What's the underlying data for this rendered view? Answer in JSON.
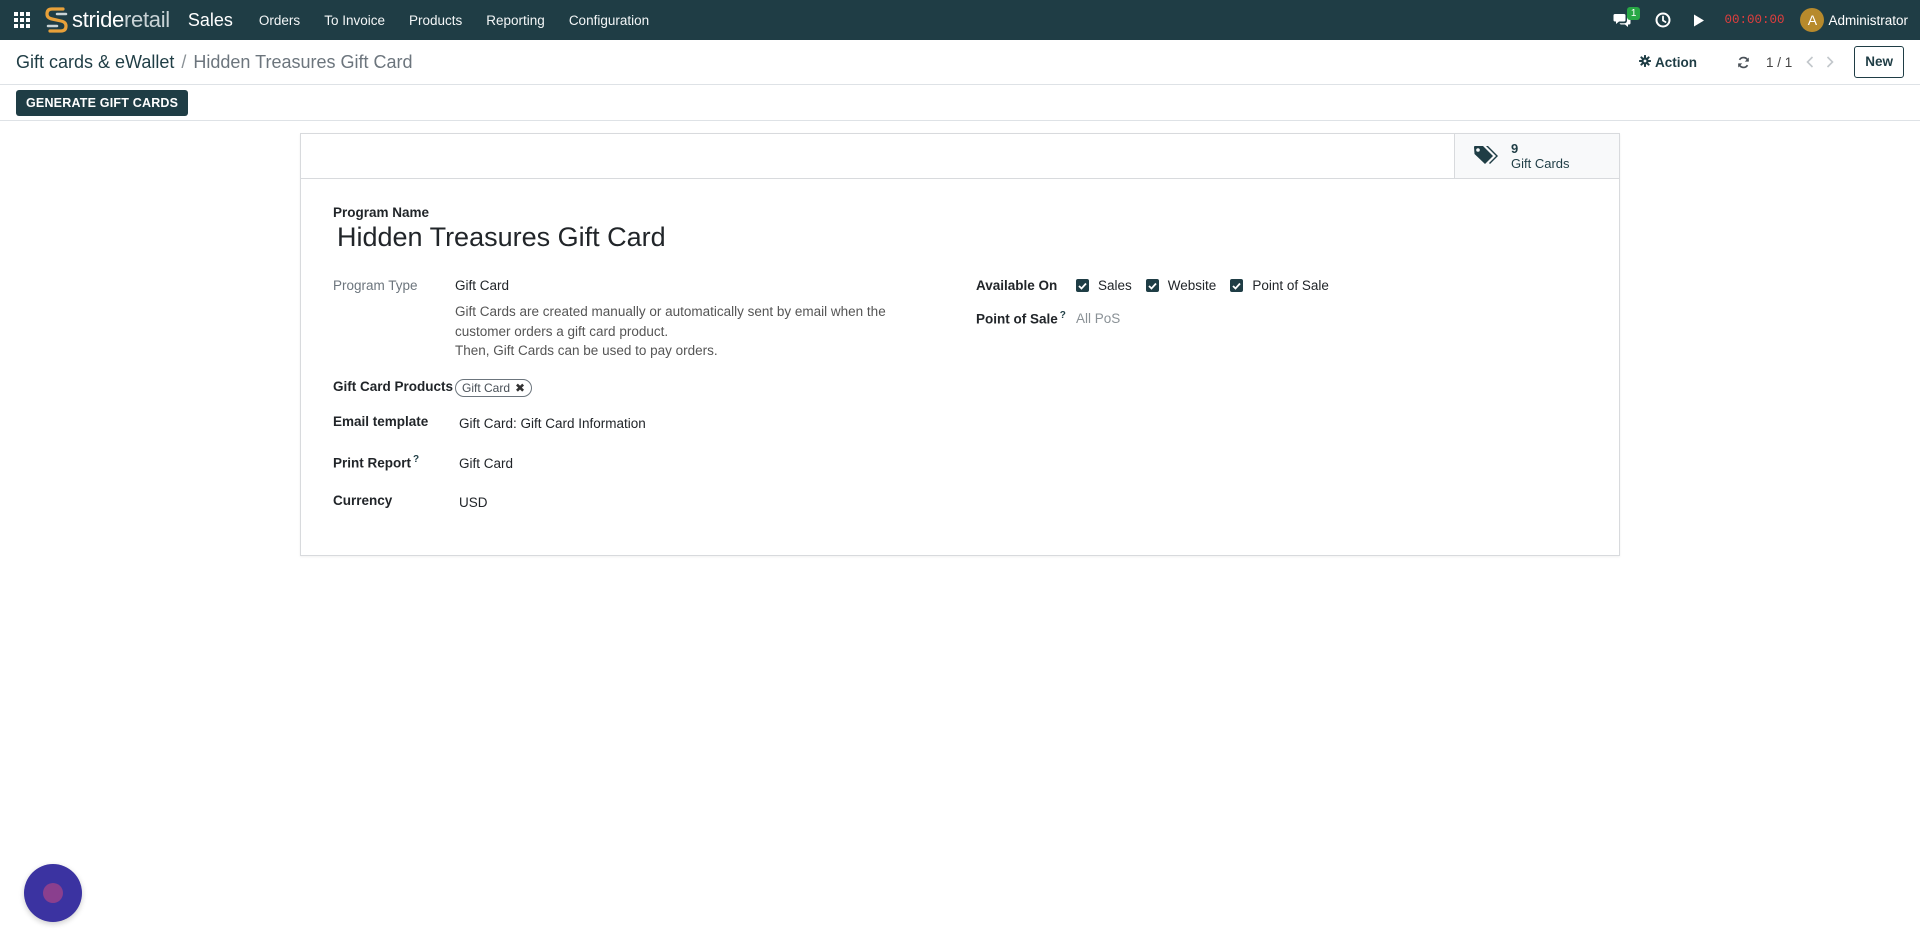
{
  "navbar": {
    "brand_part1": "stride",
    "brand_part2": "retail",
    "app_name": "Sales",
    "menu": [
      "Orders",
      "To Invoice",
      "Products",
      "Reporting",
      "Configuration"
    ],
    "messages_count": "1",
    "timer": "00:00:00",
    "avatar_letter": "A",
    "user_name": "Administrator"
  },
  "control_panel": {
    "breadcrumb_parent": "Gift cards & eWallet",
    "breadcrumb_separator": "/",
    "breadcrumb_current": "Hidden Treasures Gift Card",
    "action_label": "Action",
    "pager": "1 / 1",
    "new_label": "New"
  },
  "statusbar": {
    "generate_label": "GENERATE GIFT CARDS"
  },
  "stat_button": {
    "value": "9",
    "label": "Gift Cards"
  },
  "form": {
    "program_name_label": "Program Name",
    "program_name": "Hidden Treasures Gift Card",
    "program_type_label": "Program Type",
    "program_type": "Gift Card",
    "description_line1": "Gift Cards are created manually or automatically sent by email when the customer orders a gift card product.",
    "description_line2": "Then, Gift Cards can be used to pay orders.",
    "gift_card_products_label": "Gift Card Products",
    "gift_card_products_tag": "Gift Card",
    "email_template_label": "Email template",
    "email_template": "Gift Card: Gift Card Information",
    "print_report_label": "Print Report",
    "print_report": "Gift Card",
    "currency_label": "Currency",
    "currency": "USD",
    "help_mark": "?",
    "available_on_label": "Available On",
    "available_on": [
      {
        "label": "Sales",
        "checked": true
      },
      {
        "label": "Website",
        "checked": true
      },
      {
        "label": "Point of Sale",
        "checked": true
      }
    ],
    "point_of_sale_label": "Point of Sale",
    "point_of_sale_placeholder": "All PoS"
  },
  "colors": {
    "navbar_bg": "#1f3d45",
    "primary": "#1f3d45",
    "timer": "#e03e3e",
    "badge": "#28a745",
    "chat_bubble": "#3b33a1"
  }
}
